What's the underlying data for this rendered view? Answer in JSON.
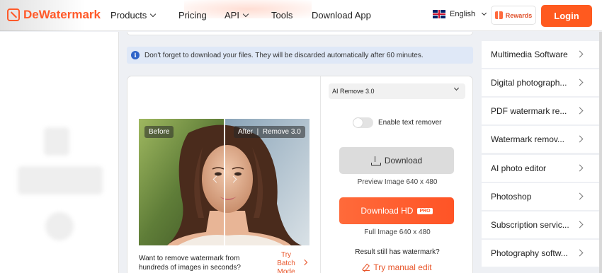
{
  "header": {
    "logo_text": "DeWatermark",
    "nav": [
      {
        "label": "Products",
        "has_dropdown": true
      },
      {
        "label": "Pricing",
        "has_dropdown": false
      },
      {
        "label": "API",
        "has_dropdown": true
      },
      {
        "label": "Tools",
        "has_dropdown": false
      },
      {
        "label": "Download App",
        "has_dropdown": false
      }
    ],
    "language": "English",
    "rewards_label": "Rewards",
    "login_label": "Login"
  },
  "notice": {
    "text": "Don't forget to download your files. They will be discarded automatically after 60 minutes."
  },
  "editor": {
    "model_select": "AI Remove 3.0",
    "before_tag": "Before",
    "after_tag": "After",
    "version_tag": "Remove 3.0",
    "toggle_label": "Enable text remover",
    "download_label": "Download",
    "preview_text": "Preview Image 640 x 480",
    "download_hd_label": "Download HD",
    "pro_badge": "PRO",
    "full_text": "Full Image 640 x 480",
    "still_text": "Result still has watermark?",
    "manual_edit_label": "Try manual edit",
    "batch_prompt": "Want to remove watermark from hundreds of images in seconds?",
    "batch_link": "Try Batch Mode"
  },
  "sidebar": {
    "items": [
      {
        "label": "Multimedia Software"
      },
      {
        "label": "Digital photograph..."
      },
      {
        "label": "PDF watermark re..."
      },
      {
        "label": "Watermark remov..."
      },
      {
        "label": "AI photo editor"
      },
      {
        "label": "Photoshop"
      },
      {
        "label": "Subscription servic..."
      },
      {
        "label": "Photography softw..."
      }
    ]
  },
  "colors": {
    "accent": "#ff5a1f",
    "notice_bg": "#dfe8f7",
    "info_icon": "#2f64c8"
  }
}
